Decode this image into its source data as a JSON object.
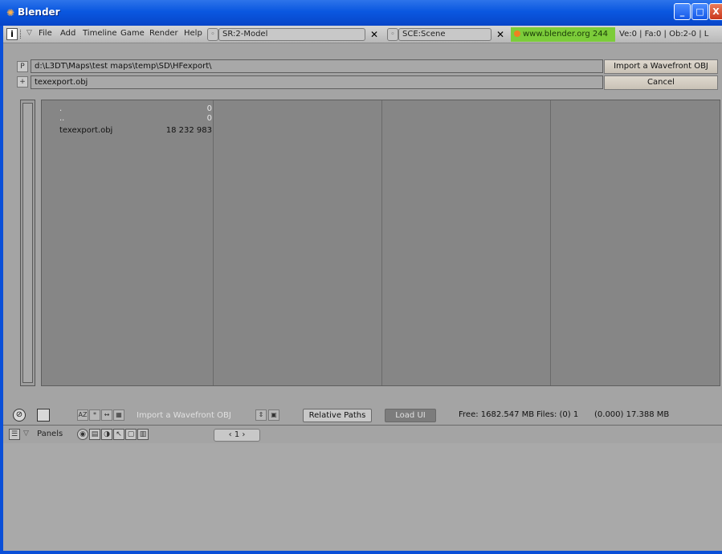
{
  "window": {
    "title": "Blender",
    "controls": {
      "minimize": "_",
      "maximize": "□",
      "close": "X"
    }
  },
  "menubar": {
    "info_icon": "i",
    "menus": [
      "File",
      "Add",
      "Timeline",
      "Game",
      "Render",
      "Help"
    ],
    "screen_field": "SR:2-Model",
    "scene_field": "SCE:Scene",
    "url": "www.blender.org 244",
    "stats": "Ve:0 | Fa:0 | Ob:2-0 | L"
  },
  "filebrowser": {
    "parent_button": "P",
    "directory_path": "d:\\L3DT\\Maps\\test maps\\temp\\SD\\HFexport\\",
    "filename": "texexport.obj",
    "import_button": "Import a Wavefront OBJ",
    "cancel_button": "Cancel",
    "entries": [
      {
        "name": ".",
        "size": "0"
      },
      {
        "name": "..",
        "size": "0"
      },
      {
        "name": "texexport.obj",
        "size": "18 232 983"
      }
    ]
  },
  "footer": {
    "sort_labels": [
      "AZ",
      "*",
      "↔",
      "▦"
    ],
    "title_ghost": "Import a Wavefront OBJ",
    "relative_paths": "Relative Paths",
    "load_ui": "Load UI",
    "free_space": "Free: 1682.547 MB",
    "files_info": "Files: (0) 1",
    "selected_info": "(0.000) 17.388 MB"
  },
  "buttons_window": {
    "panels_label": "Panels",
    "frame_value": "1"
  },
  "colors": {
    "titlebar": "#0a57e0",
    "url_highlight": "#7ccc3a",
    "file_list_bg": "#868686",
    "action_button": "#ded8ce"
  }
}
